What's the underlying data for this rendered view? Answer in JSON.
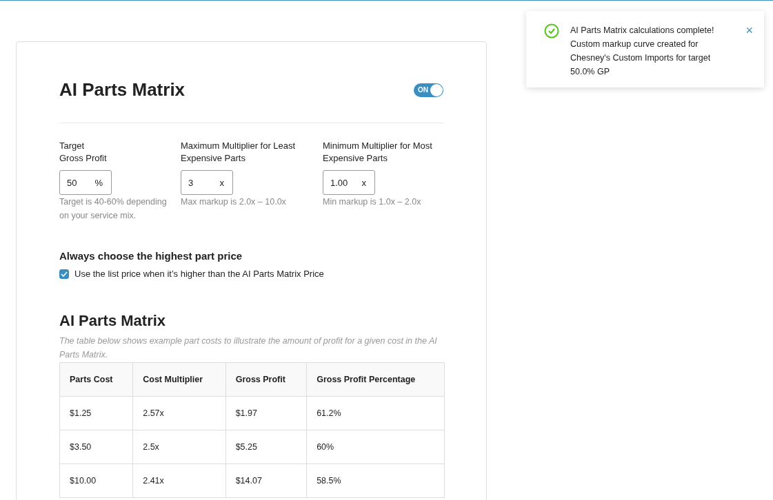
{
  "page": {
    "title": "AI Parts Matrix",
    "toggle": {
      "label": "ON",
      "on": true
    }
  },
  "fields": [
    {
      "label": "Target\nGross Profit",
      "value": "50",
      "unit": "%",
      "hint": "Target is 40-60% depending on your service mix."
    },
    {
      "label": "Maximum Multiplier for Least Expensive Parts",
      "value": "3",
      "unit": "x",
      "hint": "Max markup is 2.0x – 10.0x"
    },
    {
      "label": "Minimum Multiplier for Most Expensive Parts",
      "value": "1.00",
      "unit": "x",
      "hint": "Min markup is 1.0x – 2.0x"
    }
  ],
  "price_option": {
    "heading": "Always choose the highest part price",
    "checkbox": {
      "label": "Use the list price when it’s higher than the AI Parts Matrix Price",
      "checked": true
    }
  },
  "matrix": {
    "title": "AI Parts Matrix",
    "caption": "The table below shows example part costs to illustrate the amount of profit for a given cost in the AI Parts Matrix.",
    "columns": [
      "Parts Cost",
      "Cost Multiplier",
      "Gross Profit",
      "Gross Profit Percentage"
    ],
    "rows": [
      [
        "$1.25",
        "2.57x",
        "$1.97",
        "61.2%"
      ],
      [
        "$3.50",
        "2.5x",
        "$5.25",
        "60%"
      ],
      [
        "$10.00",
        "2.41x",
        "$14.07",
        "58.5%"
      ]
    ]
  },
  "toast": {
    "message": "AI Parts Matrix calculations complete! Custom markup curve created for Chesney's Custom Imports for target 50.0% GP",
    "close": "×"
  }
}
